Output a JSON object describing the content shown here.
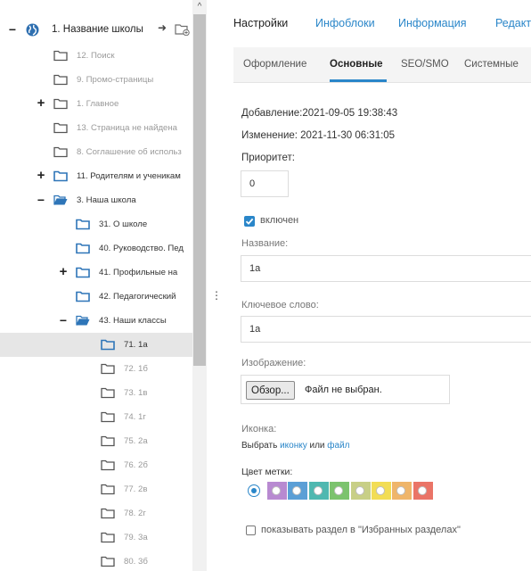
{
  "tree": {
    "root": {
      "label": "1. Название школы",
      "arrow": "➜"
    },
    "items": [
      {
        "label": "12. Поиск",
        "toggle": "",
        "folder": "closed",
        "style": "grey"
      },
      {
        "label": "9. Промо-страницы",
        "toggle": "",
        "folder": "closed",
        "style": "grey"
      },
      {
        "label": "1. Главное",
        "toggle": "+",
        "folder": "closed",
        "style": "grey"
      },
      {
        "label": "13. Страница не найдена",
        "toggle": "",
        "folder": "closed",
        "style": "grey"
      },
      {
        "label": "8. Соглашение об использ",
        "toggle": "",
        "folder": "closed",
        "style": "grey"
      },
      {
        "label": "11. Родителям и ученикам",
        "toggle": "+",
        "folder": "closed",
        "style": "dark"
      },
      {
        "label": "3. Наша школа",
        "toggle": "−",
        "folder": "open",
        "style": "dark"
      },
      {
        "label": "31. О школе",
        "toggle": "",
        "folder": "closed",
        "style": "dark"
      },
      {
        "label": "40. Руководство. Пед",
        "toggle": "",
        "folder": "closed",
        "style": "dark"
      },
      {
        "label": "41. Профильные на",
        "toggle": "+",
        "folder": "closed",
        "style": "dark"
      },
      {
        "label": "42. Педагогический",
        "toggle": "",
        "folder": "closed",
        "style": "dark"
      },
      {
        "label": "43. Наши классы",
        "toggle": "−",
        "folder": "open",
        "style": "dark"
      },
      {
        "label": "71. 1а",
        "toggle": "",
        "folder": "closed",
        "style": "dark",
        "selected": true
      },
      {
        "label": "72. 1б",
        "toggle": "",
        "folder": "closed",
        "style": "grey"
      },
      {
        "label": "73. 1в",
        "toggle": "",
        "folder": "closed",
        "style": "grey"
      },
      {
        "label": "74. 1г",
        "toggle": "",
        "folder": "closed",
        "style": "grey"
      },
      {
        "label": "75. 2а",
        "toggle": "",
        "folder": "closed",
        "style": "grey"
      },
      {
        "label": "76. 2б",
        "toggle": "",
        "folder": "closed",
        "style": "grey"
      },
      {
        "label": "77. 2в",
        "toggle": "",
        "folder": "closed",
        "style": "grey"
      },
      {
        "label": "78. 2г",
        "toggle": "",
        "folder": "closed",
        "style": "grey"
      },
      {
        "label": "79. 3а",
        "toggle": "",
        "folder": "closed",
        "style": "grey"
      },
      {
        "label": "80. 3б",
        "toggle": "",
        "folder": "closed",
        "style": "grey"
      }
    ]
  },
  "scrollbar": {
    "up_glyph": "^"
  },
  "splitter": {
    "glyph": "⋮"
  },
  "main_tabs": [
    {
      "label": "Настройки",
      "active": true
    },
    {
      "label": "Инфоблоки",
      "active": false
    },
    {
      "label": "Информация",
      "active": false
    },
    {
      "label": "Редакт",
      "active": false
    }
  ],
  "sub_tabs": [
    {
      "label": "Оформление",
      "active": false
    },
    {
      "label": "Основные",
      "active": true
    },
    {
      "label": "SEO/SMO",
      "active": false
    },
    {
      "label": "Системные",
      "active": false
    }
  ],
  "info": {
    "added": "Добавление:2021-09-05 19:38:43",
    "changed": "Изменение:  2021-11-30 06:31:05"
  },
  "form": {
    "priority_label": "Приоритет:",
    "priority_value": "0",
    "enabled_label": "включен",
    "name_label": "Название:",
    "name_value": "1а",
    "keyword_label": "Ключевое слово:",
    "keyword_value": "1а",
    "image_label": "Изображение:",
    "file_button": "Обзор...",
    "file_status": "Файл не выбран.",
    "icon_label": "Иконка:",
    "icon_text_1": "Выбрать ",
    "icon_link_1": "иконку",
    "icon_text_2": " или ",
    "icon_link_2": "файл",
    "color_label": "Цвет метки:",
    "colors": [
      "#b88ad1",
      "#5b9fd6",
      "#4fb8b0",
      "#7cc36e",
      "#c8cf86",
      "#f2dd55",
      "#efb56a",
      "#ea7467"
    ],
    "favorites_label": "показывать раздел в \"Избранных разделах\""
  },
  "palette": {
    "accent": "#2a86c9",
    "folder": "#2e75b8"
  }
}
